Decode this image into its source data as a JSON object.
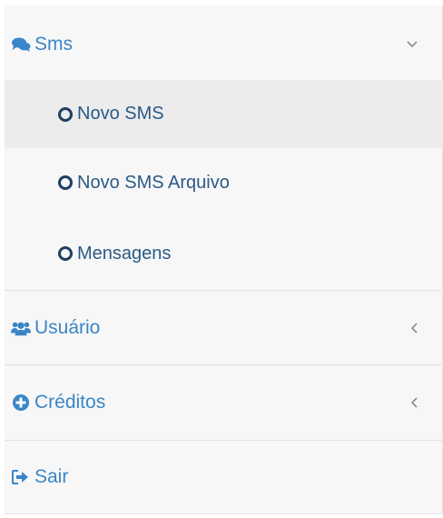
{
  "menu": {
    "sms": {
      "label": "Sms",
      "icon": "comments-icon",
      "chevron": "chevron-down-icon"
    },
    "submenu": [
      {
        "label": "Novo SMS",
        "active": true
      },
      {
        "label": "Novo SMS Arquivo",
        "active": false
      },
      {
        "label": "Mensagens",
        "active": false
      }
    ],
    "usuario": {
      "label": "Usuário",
      "icon": "users-icon",
      "chevron": "chevron-left-icon"
    },
    "creditos": {
      "label": "Créditos",
      "icon": "plus-circle-icon",
      "chevron": "chevron-left-icon"
    },
    "sair": {
      "label": "Sair",
      "icon": "sign-out-icon"
    }
  },
  "colors": {
    "link": "#3a86c8",
    "submenu_text": "#2b5a86",
    "active_bg": "#ececec",
    "panel_bg": "#f7f7f7",
    "chevron": "#8c8c8c"
  }
}
